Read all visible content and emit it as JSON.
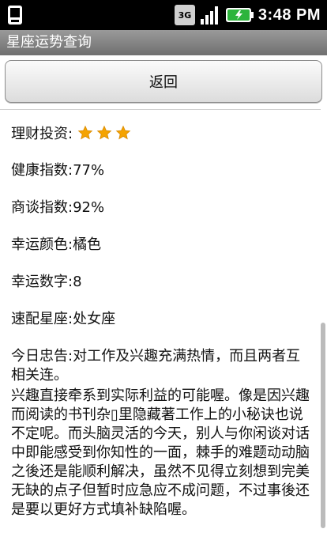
{
  "status_bar": {
    "network_label": "3G",
    "time": "3:48 PM",
    "icons": [
      "notification-icon",
      "3g-icon",
      "signal-icon",
      "battery-icon"
    ]
  },
  "app": {
    "title": "星座运势查询"
  },
  "back_button": {
    "label": "返回"
  },
  "fortune": {
    "investment_label": "理财投资:",
    "investment_rating": 3,
    "health": "健康指数:77%",
    "business": "商谈指数:92%",
    "lucky_color": "幸运颜色:橘色",
    "lucky_number": "幸运数字:8",
    "match_sign": "速配星座:处女座",
    "advice_1": "今日忠告:对工作及兴趣充满热情，而且两者互相关连。",
    "advice_2": "兴趣直接牵系到实际利益的可能喔。像是因兴趣而阅读的书刊杂▯里隐藏著工作上的小秘诀也说不定呢。而头脑灵活的今天，别人与你闲谈对话中即能感受到你知性的一面，棘手的难题动动脑之後还是能顺利解决，虽然不见得立刻想到完美无缺的点子但暂时应急应不成问题，不过事後还是要以更好方式填补缺陷喔。"
  },
  "colors": {
    "star": "#f5a300",
    "title_bar": "#7f7f7f"
  }
}
